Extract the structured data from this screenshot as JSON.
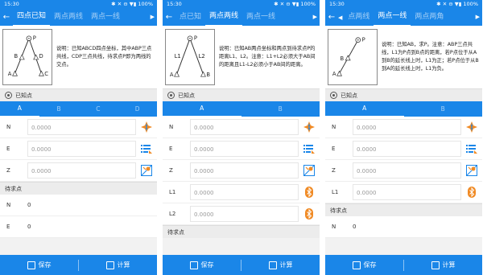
{
  "status": {
    "time": "15:30",
    "icons": "✱ ✕ ⊖ ▼▮",
    "battery": "100%"
  },
  "colors": {
    "primary": "#1a86e8"
  },
  "screens": [
    {
      "tabs": [
        "四点已知",
        "两点两线",
        "两点一线"
      ],
      "active_tab": 0,
      "description": "说明：已知ABCD四点坐标，其中ABP三点共线，CDP三点共线，待求点P即为两线的交点。",
      "known_section": "已知点",
      "point_tabs": [
        "A",
        "B",
        "C",
        "D"
      ],
      "fields": [
        {
          "label": "N",
          "placeholder": "0.0000",
          "icon": "compass-icon"
        },
        {
          "label": "E",
          "placeholder": "0.0000",
          "icon": "list-icon"
        },
        {
          "label": "Z",
          "placeholder": "0.0000",
          "icon": "map-icon"
        }
      ],
      "result_section": "待求点",
      "results": [
        {
          "label": "N",
          "value": "0"
        },
        {
          "label": "E",
          "value": "0"
        }
      ],
      "save_label": "保存",
      "calc_label": "计算"
    },
    {
      "tabs": [
        "点已知",
        "两点两线",
        "两点一线"
      ],
      "active_tab": 1,
      "description": "说明：已知AB两点坐标和两点到待求点P的距离L1、L2。注意：L1+L2必须大于AB间的距离且L1-L2必须小于AB间的距离。",
      "known_section": "已知点",
      "point_tabs": [
        "A",
        "B"
      ],
      "fields": [
        {
          "label": "N",
          "placeholder": "0.0000",
          "icon": "compass-icon"
        },
        {
          "label": "E",
          "placeholder": "0.0000",
          "icon": "list-icon"
        },
        {
          "label": "Z",
          "placeholder": "0.0000",
          "icon": "map-icon"
        },
        {
          "label": "L1",
          "placeholder": "0.0000",
          "icon": "bluetooth-icon"
        },
        {
          "label": "L2",
          "placeholder": "0.0000",
          "icon": "bluetooth-icon"
        }
      ],
      "result_section": "待求点",
      "results": [],
      "save_label": "保存",
      "calc_label": "计算"
    },
    {
      "tabs": [
        "点两线",
        "两点一线",
        "两点两角"
      ],
      "active_tab": 1,
      "description": "说明：已知AB，求P。注意：ABP三点共线，L1为P点到B点的距离，若P点位于从A到B的延长线上时，L1为正；若P点位于从B到A的延长线上时，L1为负。",
      "known_section": "已知点",
      "point_tabs": [
        "A",
        "B"
      ],
      "fields": [
        {
          "label": "N",
          "placeholder": "0.0000",
          "icon": "compass-icon"
        },
        {
          "label": "E",
          "placeholder": "0.0000",
          "icon": "list-icon"
        },
        {
          "label": "Z",
          "placeholder": "0.0000",
          "icon": "map-icon"
        },
        {
          "label": "L1",
          "placeholder": "0.0000",
          "icon": "bluetooth-icon"
        }
      ],
      "result_section": "待求点",
      "results": [
        {
          "label": "N",
          "value": "0"
        }
      ],
      "save_label": "保存",
      "calc_label": "计算"
    }
  ]
}
